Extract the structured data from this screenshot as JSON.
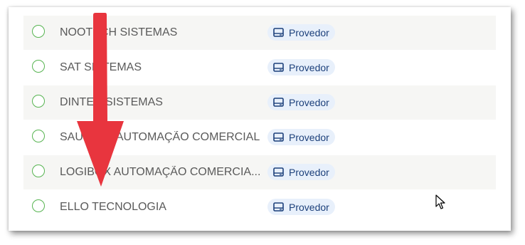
{
  "badge_label": "Provedor",
  "rows": [
    {
      "name": "NOOTECH SISTEMAS"
    },
    {
      "name": "SAT SISTEMAS"
    },
    {
      "name": "DINTEC SISTEMAS"
    },
    {
      "name": "SAUTOS - AUTOMAÇÃO COMERCIAL"
    },
    {
      "name": "LOGIBOX AUTOMAÇÃO COMERCIA..."
    },
    {
      "name": "ELLO TECNOLOGIA"
    }
  ],
  "colors": {
    "radio_border": "#57b451",
    "badge_bg": "#e8f0fb",
    "badge_text": "#1b3f7a",
    "annotation_arrow": "#e8353e"
  },
  "icons": {
    "badge_icon": "card-icon",
    "cursor": "mouse-pointer-icon",
    "annotation": "down-arrow-icon"
  }
}
